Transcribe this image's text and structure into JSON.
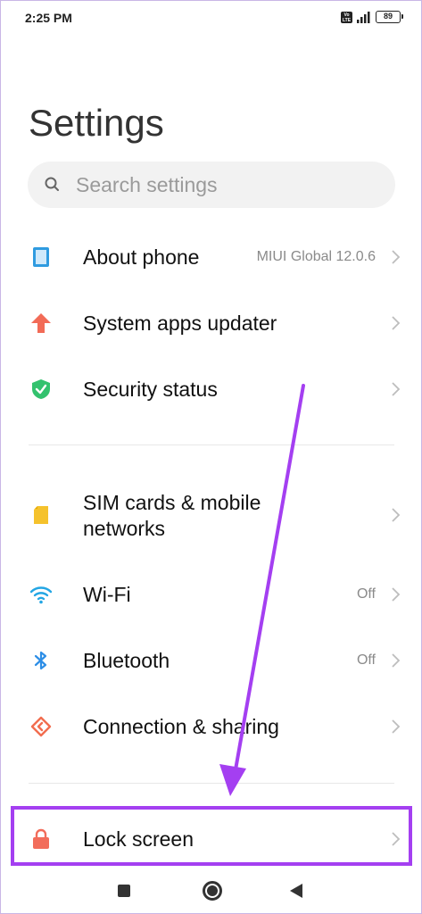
{
  "status_bar": {
    "time": "2:25 PM",
    "volte_label": "Vo\nLTE",
    "battery": "89"
  },
  "page": {
    "title": "Settings"
  },
  "search": {
    "placeholder": "Search settings",
    "icon": "search-icon"
  },
  "items": [
    {
      "label": "About phone",
      "value": "MIUI Global 12.0.6",
      "icon": "phone-icon",
      "color": "#2f9be0"
    },
    {
      "label": "System apps updater",
      "value": "",
      "icon": "arrow-up-icon",
      "color": "#f26b57"
    },
    {
      "label": "Security status",
      "value": "",
      "icon": "shield-check-icon",
      "color": "#33c26e"
    },
    {
      "label": "SIM cards & mobile networks",
      "value": "",
      "icon": "sim-card-icon",
      "color": "#f5c22c"
    },
    {
      "label": "Wi-Fi",
      "value": "Off",
      "icon": "wifi-icon",
      "color": "#23a6e4"
    },
    {
      "label": "Bluetooth",
      "value": "Off",
      "icon": "bluetooth-icon",
      "color": "#2d8ee6"
    },
    {
      "label": "Connection & sharing",
      "value": "",
      "icon": "connection-sharing-icon",
      "color": "#f26d4f"
    },
    {
      "label": "Lock screen",
      "value": "",
      "icon": "lock-icon",
      "color": "#f26d5b"
    }
  ],
  "annotation": {
    "highlight_color": "#a43ff1"
  }
}
